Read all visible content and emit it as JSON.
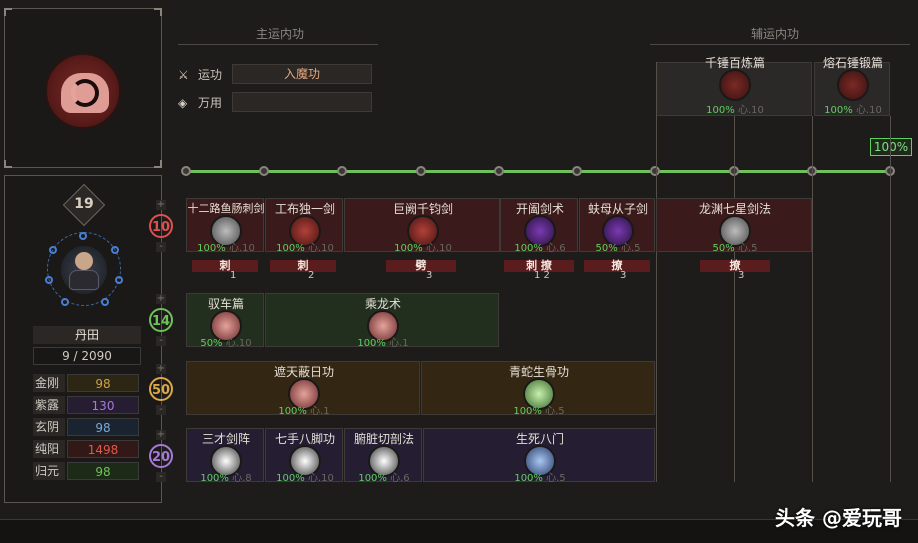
{
  "header": {
    "main_title": "主运内功",
    "aux_title": "辅运内功"
  },
  "main_slots": [
    {
      "label": "运功",
      "value": "入魔功"
    },
    {
      "label": "万用",
      "value": ""
    }
  ],
  "aux_slots": [
    {
      "name": "千锤百炼篇",
      "pct": "100%",
      "xin": "心.10"
    },
    {
      "name": "熔石锤锻篇",
      "pct": "100%",
      "xin": "心.10"
    }
  ],
  "rail_percent": "100%",
  "character": {
    "level": "19",
    "dantian_label": "丹田",
    "dantian_value": "9 / 2090",
    "stats": [
      {
        "label": "金刚",
        "value": "98",
        "color": "#c8a44a"
      },
      {
        "label": "紫露",
        "value": "130",
        "color": "#a67ad6"
      },
      {
        "label": "玄阴",
        "value": "98",
        "color": "#7aa8d6"
      },
      {
        "label": "纯阳",
        "value": "1498",
        "color": "#e05a4a"
      },
      {
        "label": "归元",
        "value": "98",
        "color": "#6fc25a"
      }
    ]
  },
  "tiers": [
    {
      "num": "10",
      "color": "#e05050"
    },
    {
      "num": "14",
      "color": "#6fc25a"
    },
    {
      "num": "50",
      "color": "#d9a84a"
    },
    {
      "num": "20",
      "color": "#a67ad6"
    }
  ],
  "tier_arrows": [
    "+",
    "-"
  ],
  "skills": {
    "row1": [
      {
        "name": "十二路鱼肠刺剑",
        "pct": "100%",
        "xin": "心.10",
        "tag": "刺",
        "num": "1"
      },
      {
        "name": "工布独一剑",
        "pct": "100%",
        "xin": "心.10",
        "tag": "刺",
        "num": "2"
      },
      {
        "name": "巨阙千钧剑",
        "pct": "100%",
        "xin": "心.10",
        "tag": "劈",
        "num": "3"
      },
      {
        "name": "开阖剑术",
        "pct": "100%",
        "xin": "心.6",
        "tag": "刺 撩",
        "num": "1   2"
      },
      {
        "name": "蚨母从子剑",
        "pct": "50%",
        "xin": "心.5",
        "tag": "撩",
        "num": "3"
      },
      {
        "name": "龙渊七星剑法",
        "pct": "50%",
        "xin": "心.5",
        "tag": "撩",
        "num": "3"
      }
    ],
    "row2": [
      {
        "name": "驭车篇",
        "pct": "50%",
        "xin": "心.10"
      },
      {
        "name": "乘龙术",
        "pct": "100%",
        "xin": "心.1"
      }
    ],
    "row3": [
      {
        "name": "遮天蔽日功",
        "pct": "100%",
        "xin": "心.1"
      },
      {
        "name": "青蛇生骨功",
        "pct": "100%",
        "xin": "心.5"
      }
    ],
    "row4": [
      {
        "name": "三才剑阵",
        "pct": "100%",
        "xin": "心.8"
      },
      {
        "name": "七手八脚功",
        "pct": "100%",
        "xin": "心.10"
      },
      {
        "name": "腑脏切剖法",
        "pct": "100%",
        "xin": "心.6"
      },
      {
        "name": "生死八门",
        "pct": "100%",
        "xin": "心.5"
      }
    ]
  },
  "watermark": "头条 @爱玩哥",
  "icons": [
    "crossed-swords-icon",
    "diamond-cog-icon",
    "yin-yang-icon",
    "hands-icon"
  ]
}
